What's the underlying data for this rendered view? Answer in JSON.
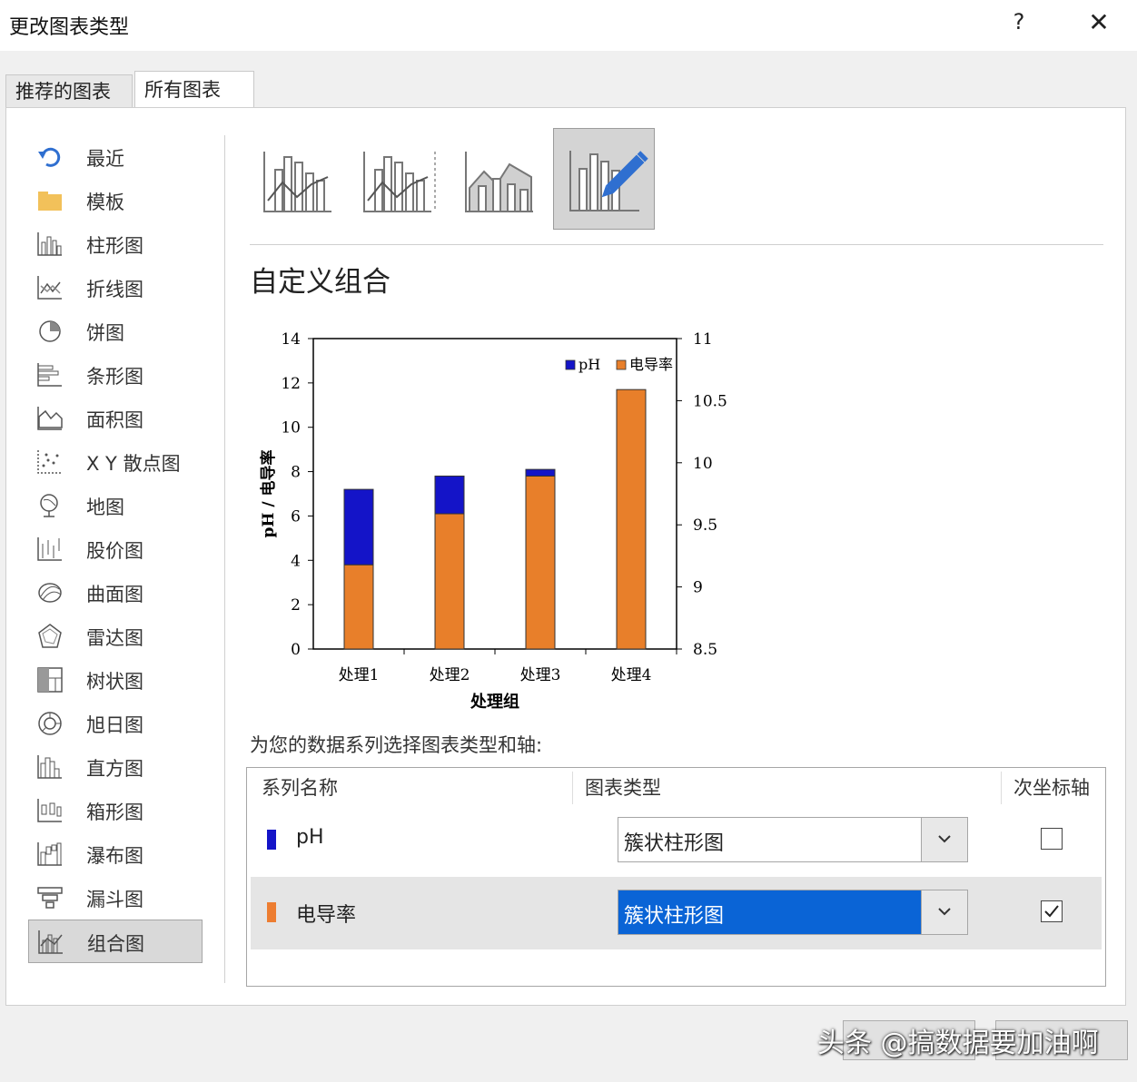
{
  "dialog": {
    "title": "更改图表类型",
    "help": "?",
    "close": "✕"
  },
  "tabs": [
    {
      "label": "推荐的图表"
    },
    {
      "label": "所有图表"
    }
  ],
  "sidebar": {
    "items": [
      {
        "label": "最近",
        "icon": "recent-icon"
      },
      {
        "label": "模板",
        "icon": "folder-icon"
      },
      {
        "label": "柱形图",
        "icon": "column-chart-icon"
      },
      {
        "label": "折线图",
        "icon": "line-chart-icon"
      },
      {
        "label": "饼图",
        "icon": "pie-chart-icon"
      },
      {
        "label": "条形图",
        "icon": "bar-chart-icon"
      },
      {
        "label": "面积图",
        "icon": "area-chart-icon"
      },
      {
        "label": "X Y 散点图",
        "icon": "scatter-chart-icon"
      },
      {
        "label": "地图",
        "icon": "map-chart-icon"
      },
      {
        "label": "股价图",
        "icon": "stock-chart-icon"
      },
      {
        "label": "曲面图",
        "icon": "surface-chart-icon"
      },
      {
        "label": "雷达图",
        "icon": "radar-chart-icon"
      },
      {
        "label": "树状图",
        "icon": "treemap-chart-icon"
      },
      {
        "label": "旭日图",
        "icon": "sunburst-chart-icon"
      },
      {
        "label": "直方图",
        "icon": "histogram-chart-icon"
      },
      {
        "label": "箱形图",
        "icon": "box-chart-icon"
      },
      {
        "label": "瀑布图",
        "icon": "waterfall-chart-icon"
      },
      {
        "label": "漏斗图",
        "icon": "funnel-chart-icon"
      },
      {
        "label": "组合图",
        "icon": "combo-chart-icon",
        "selected": true
      }
    ]
  },
  "main": {
    "heading": "自定义组合",
    "prompt": "为您的数据系列选择图表类型和轴:",
    "table": {
      "headers": {
        "series": "系列名称",
        "type": "图表类型",
        "secondary": "次坐标轴"
      },
      "rows": [
        {
          "name": "pH",
          "type": "簇状柱形图",
          "secondary": false,
          "color": "#1414c8"
        },
        {
          "name": "电导率",
          "type": "簇状柱形图",
          "secondary": true,
          "color": "#ed7d31"
        }
      ]
    }
  },
  "chart_data": {
    "type": "bar",
    "categories": [
      "处理1",
      "处理2",
      "处理3",
      "处理4"
    ],
    "series": [
      {
        "name": "pH",
        "values": [
          7.2,
          7.8,
          8.1,
          null
        ],
        "color": "#1414c8"
      },
      {
        "name": "电导率",
        "values": [
          3.8,
          6.1,
          7.8,
          11.7
        ],
        "color": "#e87f2a"
      }
    ],
    "xlabel": "处理组",
    "ylabel": "pH / 电导率",
    "ylim": [
      0,
      14
    ],
    "yticks": [
      "0",
      "2",
      "4",
      "6",
      "8",
      "10",
      "12",
      "14"
    ],
    "y2ticks": [
      "8.5",
      "9",
      "9.5",
      "10",
      "10.5",
      "11"
    ],
    "y2lim": [
      8.5,
      11
    ],
    "legend": "top-right"
  },
  "watermark": "头条 @搞数据要加油啊"
}
